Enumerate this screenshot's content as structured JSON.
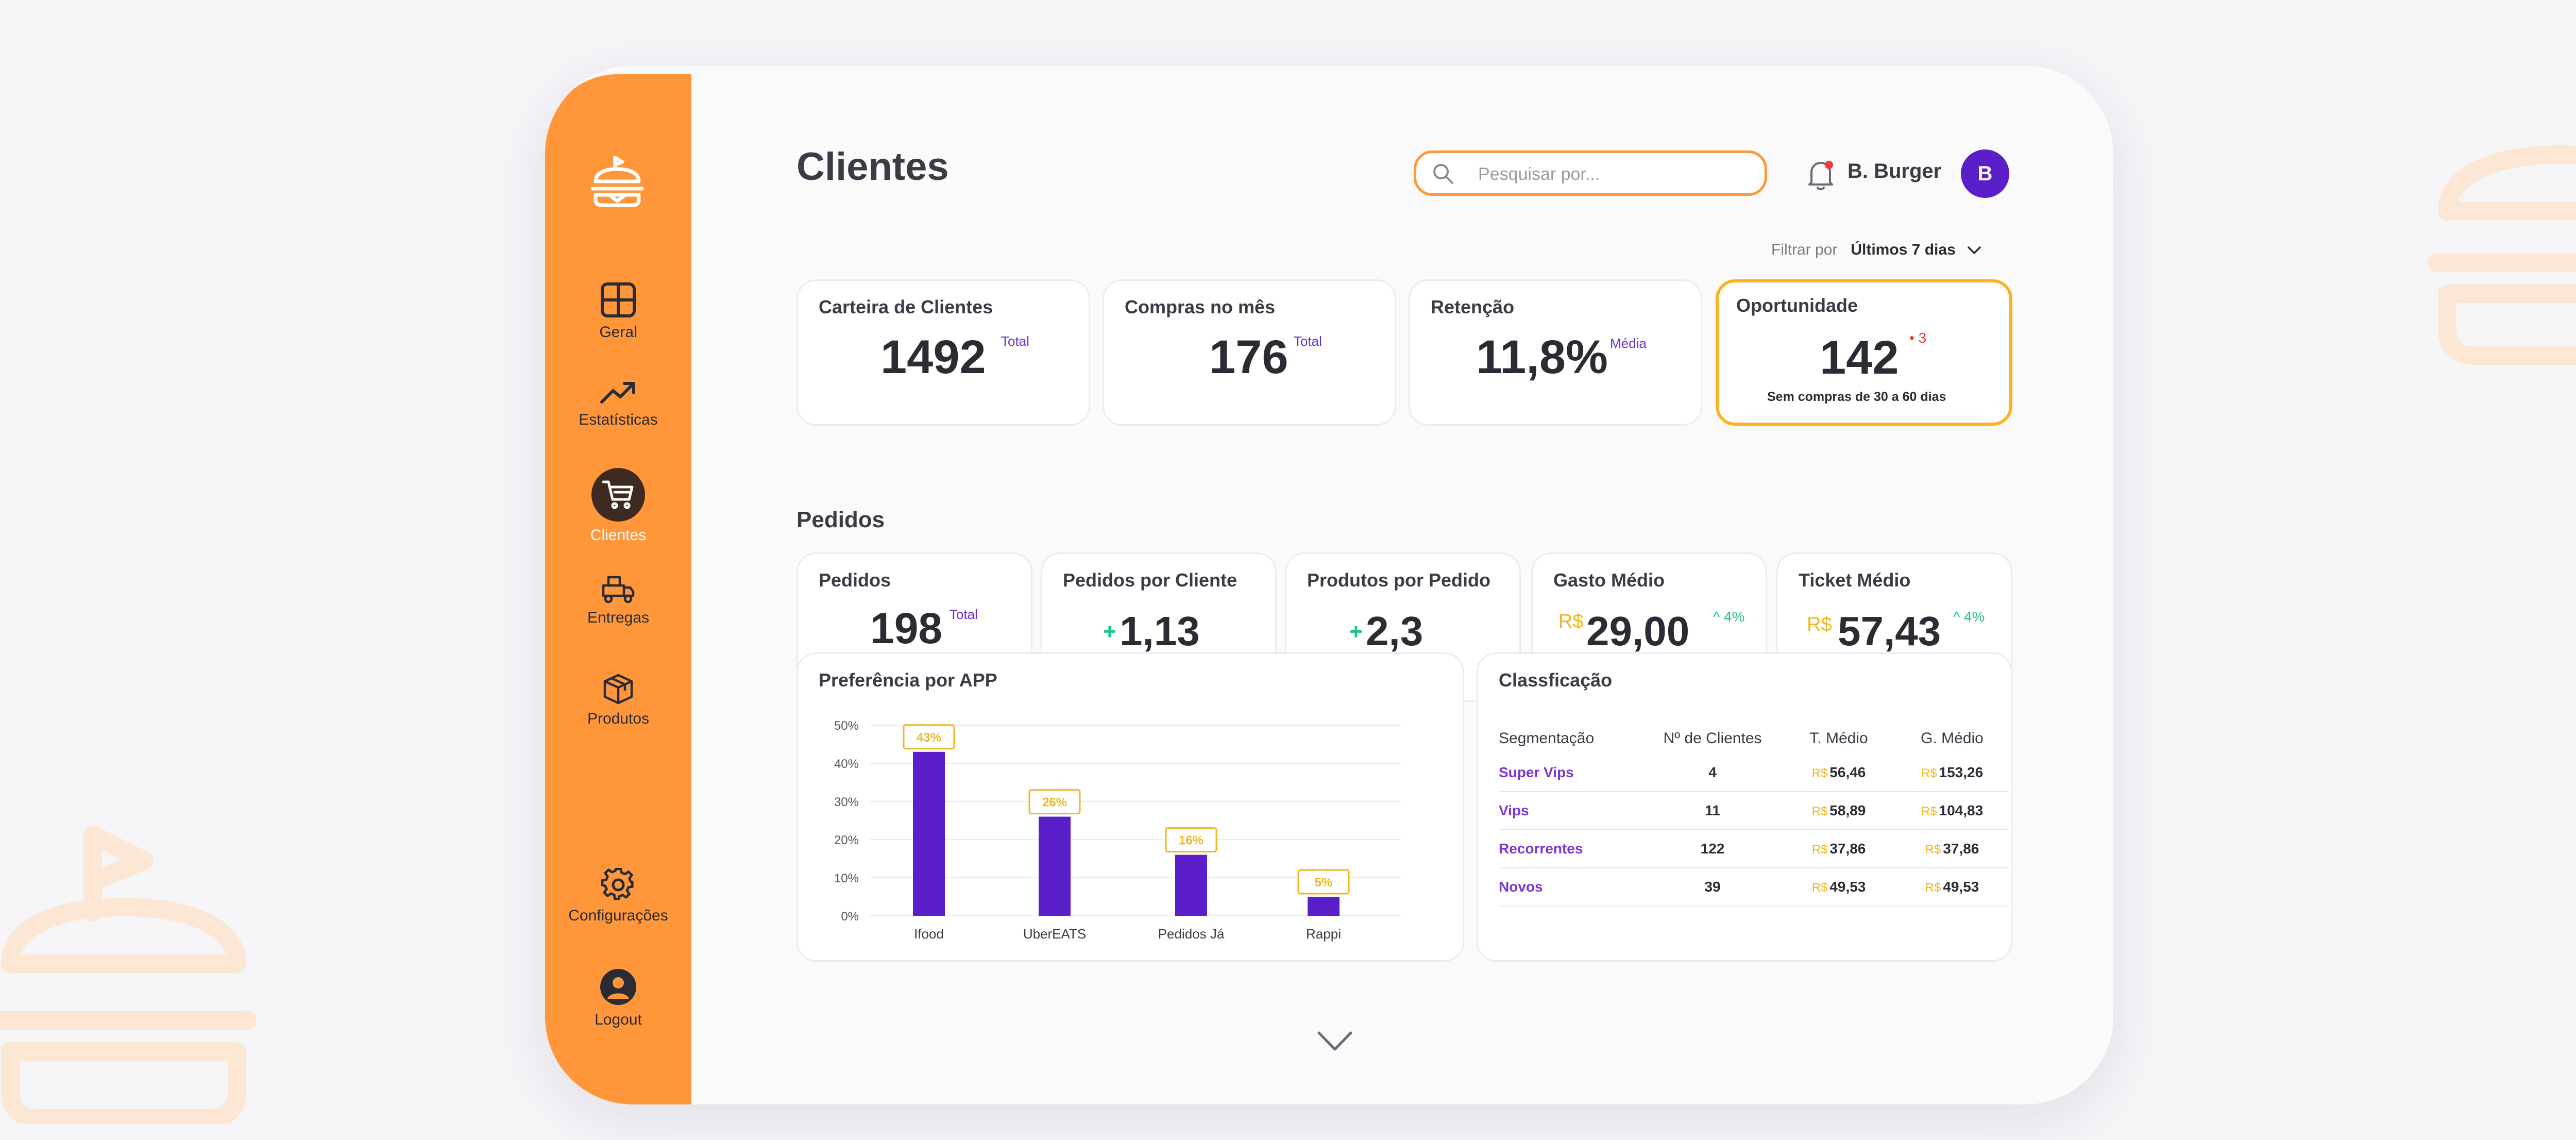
{
  "sidebar": {
    "items": [
      {
        "label": "Geral",
        "icon": "grid-icon"
      },
      {
        "label": "Estatísticas",
        "icon": "trending-up-icon"
      },
      {
        "label": "Clientes",
        "icon": "cart-icon",
        "active": true
      },
      {
        "label": "Entregas",
        "icon": "delivery-truck-icon"
      },
      {
        "label": "Produtos",
        "icon": "box-icon"
      },
      {
        "label": "Configurações",
        "icon": "gear-icon"
      },
      {
        "label": "Logout",
        "icon": "user-icon"
      }
    ]
  },
  "header": {
    "title": "Clientes",
    "search_placeholder": "Pesquisar por...",
    "user_name": "B. Burger",
    "avatar_letter": "B"
  },
  "filter": {
    "label": "Filtrar por",
    "value": "Últimos 7 dias"
  },
  "kpis": {
    "carteira": {
      "title": "Carteira de Clientes",
      "value": "1492",
      "tag": "Total"
    },
    "compras": {
      "title": "Compras no mês",
      "value": "176",
      "tag": "Total"
    },
    "retencao": {
      "title": "Retenção",
      "value": "11,8%",
      "tag": "Média"
    },
    "oportunidade": {
      "title": "Oportunidade",
      "value": "142",
      "badge": "3",
      "note": "Sem compras de 30 a 60 dias"
    }
  },
  "pedidos": {
    "section_title": "Pedidos",
    "pedidos": {
      "title": "Pedidos",
      "value": "198",
      "tag": "Total"
    },
    "por_cliente": {
      "title": "Pedidos por Cliente",
      "value": "1,13",
      "sign": "+"
    },
    "produtos_pedido": {
      "title": "Produtos por Pedido",
      "value": "2,3",
      "sign": "+"
    },
    "gasto_medio": {
      "title": "Gasto Médio",
      "currency": "R$",
      "value": "29,00",
      "change": "4%"
    },
    "ticket_medio": {
      "title": "Ticket Médio",
      "currency": "R$",
      "value": "57,43",
      "change": "4%"
    }
  },
  "chart_data": {
    "type": "bar",
    "title": "Preferência por APP",
    "categories": [
      "Ifood",
      "UberEATS",
      "Pedidos Já",
      "Rappi"
    ],
    "values": [
      43,
      26,
      16,
      5
    ],
    "value_labels": [
      "43%",
      "26%",
      "16%",
      "5%"
    ],
    "y_ticks": [
      "0%",
      "10%",
      "20%",
      "30%",
      "40%",
      "50%"
    ],
    "ylim": [
      0,
      50
    ],
    "bar_color": "#5a1fc8",
    "label_color": "#f2b51c",
    "grid": true
  },
  "classificacao": {
    "title": "Classficação",
    "headers": [
      "Segmentação",
      "Nº de Clientes",
      "T. Médio",
      "G. Médio"
    ],
    "currency": "R$",
    "rows": [
      {
        "seg": "Super Vips",
        "n": "4",
        "t": "56,46",
        "g": "153,26"
      },
      {
        "seg": "Vips",
        "n": "11",
        "t": "58,89",
        "g": "104,83"
      },
      {
        "seg": "Recorrentes",
        "n": "122",
        "t": "37,86",
        "g": "37,86"
      },
      {
        "seg": "Novos",
        "n": "39",
        "t": "49,53",
        "g": "49,53"
      }
    ]
  },
  "colors": {
    "accent": "#ff973a",
    "primary": "#5a1fc8",
    "highlight": "#ffb21e",
    "positive": "#20c08a",
    "alert": "#f03a3a"
  }
}
